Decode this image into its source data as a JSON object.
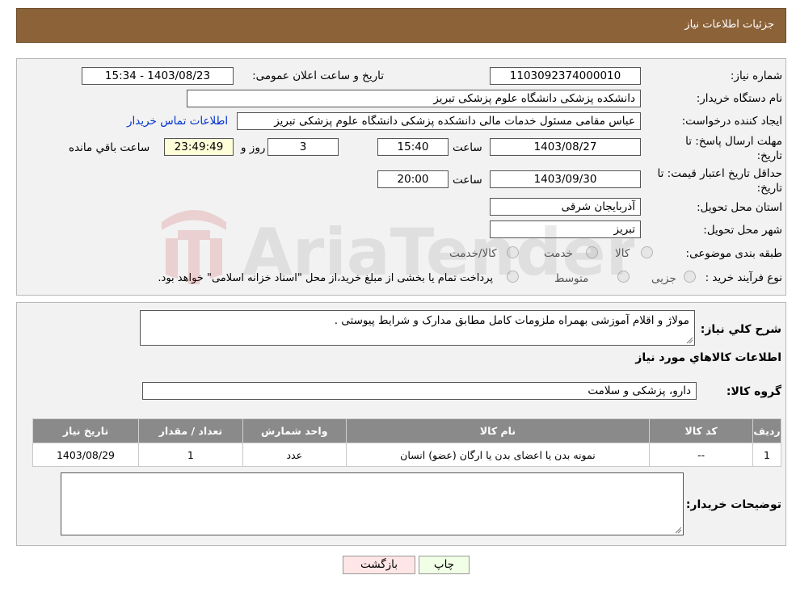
{
  "header": {
    "title": "جزئیات اطلاعات نیاز"
  },
  "form": {
    "need_number_label": "شماره نیاز:",
    "need_number": "1103092374000010",
    "announce_label": "تاریخ و ساعت اعلان عمومی:",
    "announce_value": "1403/08/23 - 15:34",
    "buyer_org_label": "نام دستگاه خریدار:",
    "buyer_org": "دانشکده پزشکی دانشگاه علوم پزشکی تبریز",
    "creator_label": "ایجاد کننده درخواست:",
    "creator": "عباس مقامی مسئول خدمات مالی دانشکده پزشکی دانشگاه علوم پزشکی تبریز",
    "contact_link": "اطلاعات تماس خریدار",
    "deadline_label_1": "مهلت ارسال پاسخ: تا",
    "deadline_label_2": "تاریخ:",
    "deadline_date": "1403/08/27",
    "time_label": "ساعت",
    "deadline_time": "15:40",
    "days_value": "3",
    "days_label": "روز و",
    "remaining_time": "23:49:49",
    "remaining_label": "ساعت باقي مانده",
    "validity_label_1": "حداقل تاریخ اعتبار قیمت: تا",
    "validity_label_2": "تاریخ:",
    "validity_date": "1403/09/30",
    "validity_time": "20:00",
    "province_label": "استان محل تحویل:",
    "province": "آذربایجان شرقی",
    "city_label": "شهر محل تحویل:",
    "city": "تبریز",
    "category_label": "طبقه بندی موضوعی:",
    "category_options": [
      "کالا",
      "خدمت",
      "کالا/خدمت"
    ],
    "process_label": "نوع فرآیند خرید :",
    "process_options": [
      "جزیی",
      "متوسط"
    ],
    "process_note": "پرداخت تمام یا بخشی از مبلغ خرید،از محل \"اسناد خزانه اسلامی\" خواهد بود."
  },
  "summary": {
    "desc_label": "شرح کلي نياز:",
    "desc": "مولاژ و اقلام آموزشی  بهمراه ملزومات کامل مطابق مدارک و شرایط پیوستی .",
    "items_title": "اطلاعات کالاهاي مورد نياز",
    "group_label": "گروه کالا:",
    "group_value": "دارو، پزشکی و سلامت",
    "table": {
      "headers": [
        "رديف",
        "کد کالا",
        "نام کالا",
        "واحد شمارش",
        "تعداد / مقدار",
        "تاریخ نیاز"
      ],
      "rows": [
        [
          "1",
          "--",
          "نمونه بدن یا اعضای بدن یا ارگان (عضو) انسان",
          "عدد",
          "1",
          "1403/08/29"
        ]
      ]
    },
    "buyer_notes_label": "توضیحات خریدار:"
  },
  "buttons": {
    "print": "چاپ",
    "back": "بازگشت"
  },
  "watermark_text": "AriaTender.neT"
}
